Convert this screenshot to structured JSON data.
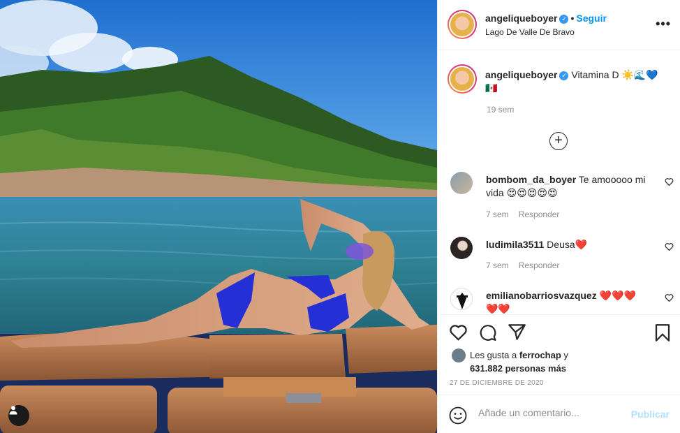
{
  "post": {
    "username": "angeliqueboyer",
    "follow_label": "Seguir",
    "location": "Lago De Valle De Bravo",
    "more_label": "•••",
    "caption_text": "Vitamina D ☀️🌊💙 ",
    "caption_emoji_tail": "🇲🇽",
    "caption_time": "19 sem",
    "load_more_label": "+"
  },
  "comments": [
    {
      "username": "bombom_da_boyer",
      "text": "Te amooooo mi vida 😍😍😍😍😍",
      "time": "7 sem",
      "reply_label": "Responder"
    },
    {
      "username": "ludimila3511",
      "text": "Deusa❤️",
      "time": "7 sem",
      "reply_label": "Responder"
    },
    {
      "username": "emilianobarriosvazquez",
      "text": "❤️❤️❤️❤️❤️",
      "time": "",
      "reply_label": ""
    }
  ],
  "likes": {
    "prefix": "Les gusta a ",
    "first_user": "ferrochap",
    "connector": " y",
    "others": "631.882 personas más"
  },
  "date": "27 DE DICIEMBRE DE 2020",
  "add_comment": {
    "placeholder": "Añade un comentario...",
    "publish_label": "Publicar"
  },
  "icons": {
    "like": "heart-icon",
    "comment": "comment-bubble-icon",
    "share": "paper-plane-icon",
    "save": "bookmark-icon",
    "emoji": "smiley-icon",
    "user_tag": "person-icon",
    "verified": "verified-badge-icon"
  },
  "colors": {
    "link_blue": "#0095f6",
    "publish_disabled": "#b2dffc",
    "muted": "#8e8e8e",
    "heart_red": "#ed4956"
  }
}
